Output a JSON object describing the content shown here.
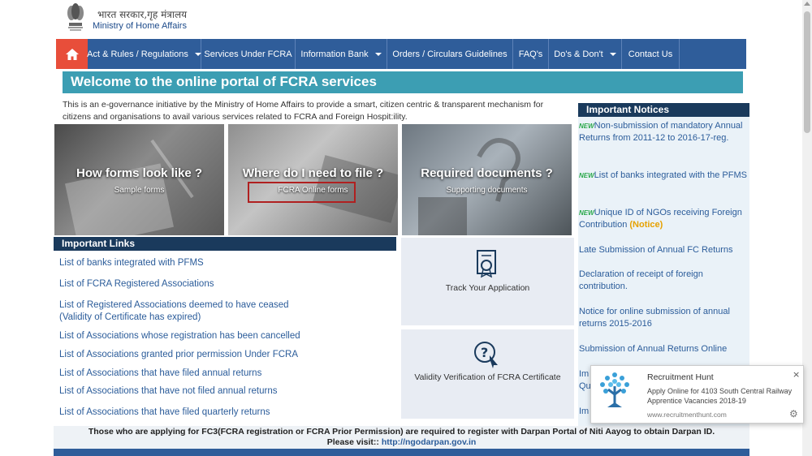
{
  "header": {
    "ministry_hindi": "भारत सरकार,गृह मंत्रालय",
    "ministry_english": "Ministry of Home Affairs"
  },
  "nav": {
    "items": [
      {
        "label": "Act & Rules / Regulations",
        "has_dropdown": true
      },
      {
        "label": "Services Under FCRA",
        "has_dropdown": false
      },
      {
        "label": "Information Bank",
        "has_dropdown": true
      },
      {
        "label": "Orders / Circulars Guidelines",
        "has_dropdown": false
      },
      {
        "label": "FAQ's",
        "has_dropdown": false
      },
      {
        "label": "Do's & Don't",
        "has_dropdown": true
      },
      {
        "label": "Contact Us",
        "has_dropdown": false
      }
    ]
  },
  "welcome": "Welcome to the online portal of FCRA services",
  "intro": "This is an e-governance initiative by the Ministry of Home Affairs to provide a smart, citizen centric & transparent mechanism for citizens and organisations to avail various   services related to FCRA and Foreign Hospit:ility.",
  "tiles": [
    {
      "title": "How forms look like ?",
      "subtitle": "Sample forms"
    },
    {
      "title": "Where do I need to file ?",
      "subtitle": "FCRA Online forms"
    },
    {
      "title": "Required documents ?",
      "subtitle": "Supporting documents"
    }
  ],
  "important_links": {
    "heading": "Important Links",
    "items": [
      "List of banks integrated with PFMS",
      "List of FCRA Registered Associations",
      "List of Registered Associations deemed to have ceased (Validity of Certificate has expired)",
      "List of Associations whose registration has been cancelled",
      "List of Associations granted prior permission Under FCRA",
      "List of Associations that have filed annual returns",
      "List of Associations that have not filed annual returns",
      "List of Associations that have filed quarterly returns"
    ]
  },
  "actions": {
    "track": "Track Your Application",
    "validity": "Validity Verification of FCRA Certificate"
  },
  "notices": {
    "heading": "Important Notices",
    "new_badge": "NEW",
    "notice_tag": "(Notice)",
    "items": [
      "Non-submission of mandatory Annual Returns from 2011-12 to 2016-17-reg.",
      "List of banks integrated with the PFMS",
      "Unique ID of NGOs receiving Foreign Contribution",
      "Late Submission of Annual FC Returns",
      "Declaration of receipt of foreign contribution.",
      "Notice for online submission of annual returns 2015-2016",
      "Submission of Annual Returns Online",
      "Im",
      "Qu",
      "Im"
    ]
  },
  "footer": {
    "line1": "Those who are applying for FC3(FCRA registration or FCRA Prior Permission) are required to register with Darpan Portal of Niti Aayog to obtain Darpan ID.",
    "line2_prefix": "Please visit:: ",
    "link": "http://ngodarpan.gov.in"
  },
  "toast": {
    "title": "Recruitment Hunt",
    "body": "Apply Online for 4103 South Central Railway Apprentice Vacancies 2018-19",
    "url": "www.recruitmenthunt.com",
    "close": "×",
    "gear": "⚙"
  },
  "colors": {
    "nav": "#2f5d9a",
    "home": "#e84e3a",
    "welcome": "#3c9eb3",
    "panel_head": "#1a3a5c",
    "link": "#2b5c9a"
  }
}
